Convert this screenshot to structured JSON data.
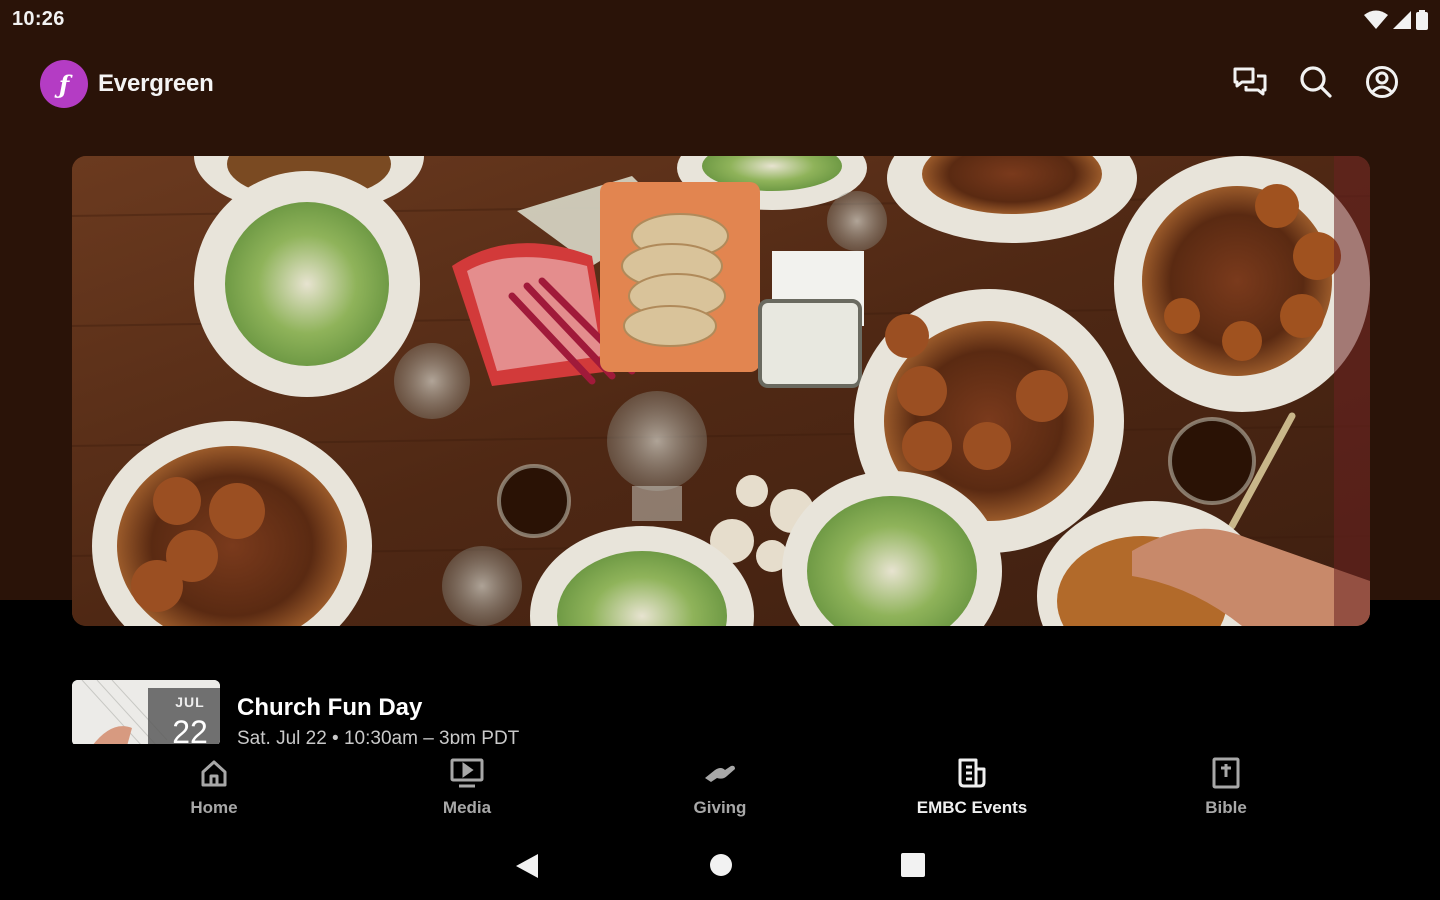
{
  "status_bar": {
    "time": "10:26"
  },
  "app": {
    "logo_letter": "ƒ",
    "title": "Evergreen"
  },
  "header_actions": [
    {
      "name": "messages-icon"
    },
    {
      "name": "search-icon"
    },
    {
      "name": "account-icon"
    }
  ],
  "hero": {
    "image": "food-table-photo"
  },
  "event": {
    "month": "JUL",
    "day": "22",
    "title": "Church Fun Day",
    "subtitle": "Sat, Jul 22 • 10:30am – 3pm PDT"
  },
  "bottom_nav": {
    "items": [
      {
        "label": "Home",
        "icon": "home-icon",
        "active": false
      },
      {
        "label": "Media",
        "icon": "media-icon",
        "active": false
      },
      {
        "label": "Giving",
        "icon": "giving-icon",
        "active": false
      },
      {
        "label": "EMBC Events",
        "icon": "events-icon",
        "active": true
      },
      {
        "label": "Bible",
        "icon": "bible-icon",
        "active": false
      }
    ]
  },
  "colors": {
    "header_bg": "#2a1308",
    "logo_bg": "#b43cc4",
    "body_bg": "#000000",
    "nav_inactive": "#a8a8a8",
    "nav_active": "#f0f0f0"
  }
}
